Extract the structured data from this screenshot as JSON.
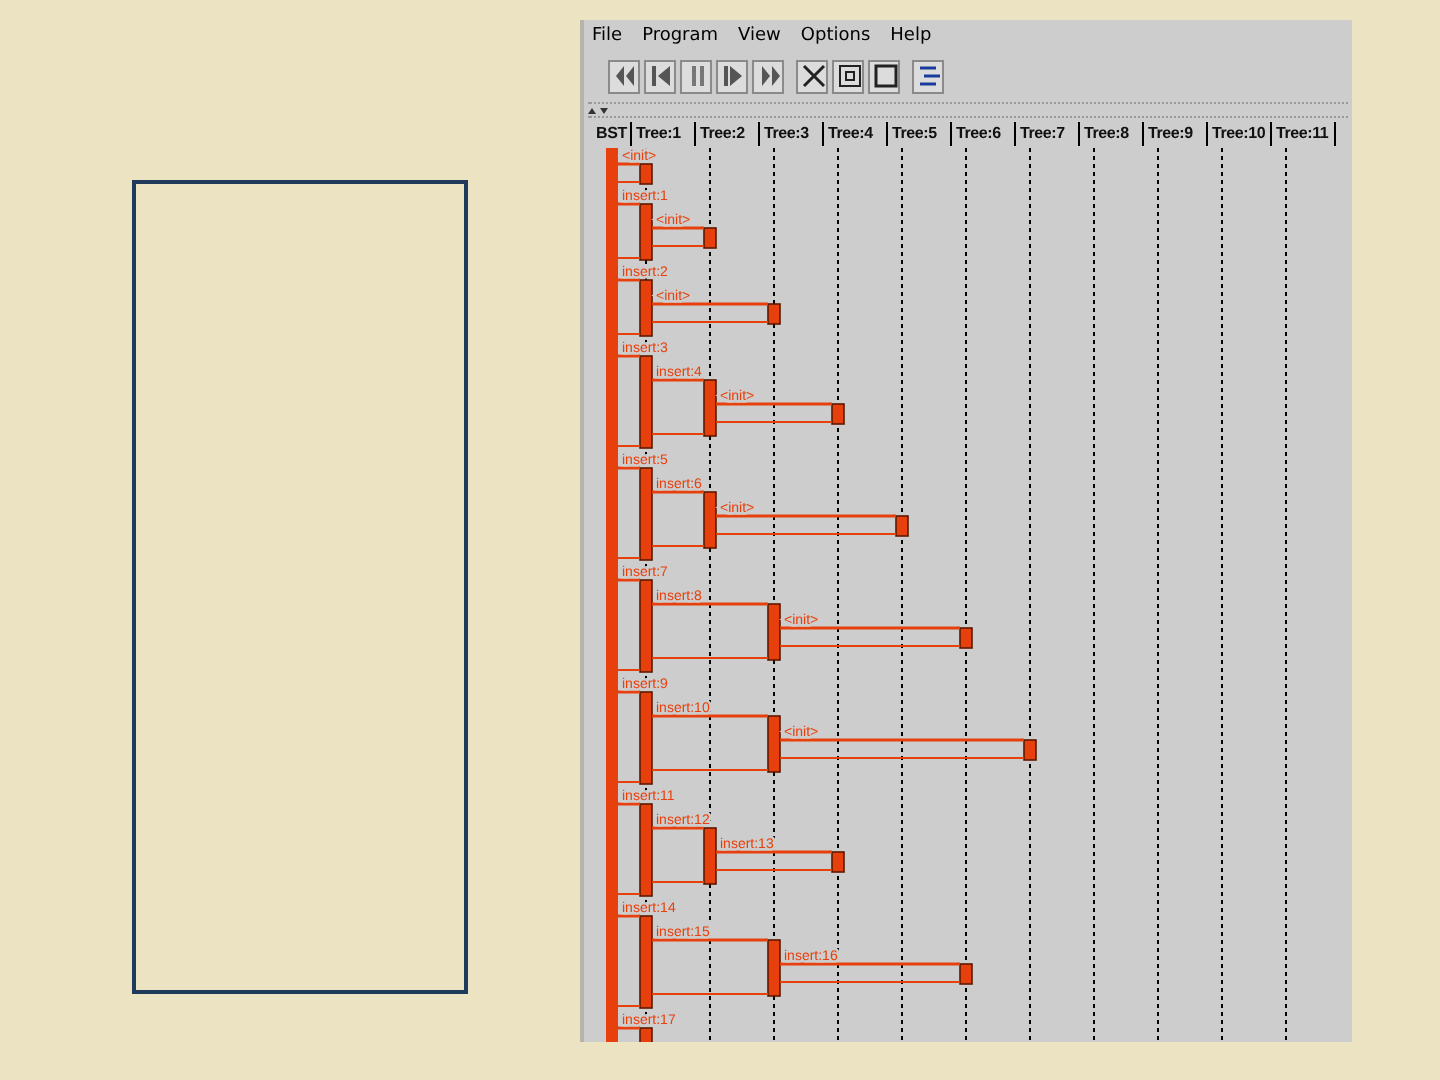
{
  "menu": [
    "File",
    "Program",
    "View",
    "Options",
    "Help"
  ],
  "lifelines": [
    "BST",
    "Tree:1",
    "Tree:2",
    "Tree:3",
    "Tree:4",
    "Tree:5",
    "Tree:6",
    "Tree:7",
    "Tree:8",
    "Tree:9",
    "Tree:10",
    "Tree:11"
  ],
  "calls": [
    {
      "label": "<init>"
    },
    {
      "label": "insert:1",
      "children": [
        {
          "label": "<init>"
        }
      ]
    },
    {
      "label": "insert:2",
      "children": [
        {
          "label": "<init>"
        }
      ]
    },
    {
      "label": "insert:3",
      "children": [
        {
          "label": "insert:4",
          "children": [
            {
              "label": "<init>"
            }
          ]
        }
      ]
    },
    {
      "label": "insert:5",
      "children": [
        {
          "label": "insert:6",
          "children": [
            {
              "label": "<init>"
            }
          ]
        }
      ]
    },
    {
      "label": "insert:7",
      "children": [
        {
          "label": "insert:8",
          "children": [
            {
              "label": "<init>"
            }
          ]
        }
      ]
    },
    {
      "label": "insert:9",
      "children": [
        {
          "label": "insert:10",
          "children": [
            {
              "label": "<init>"
            }
          ]
        }
      ]
    },
    {
      "label": "insert:11",
      "children": [
        {
          "label": "insert:12",
          "children": [
            {
              "label": "insert:13"
            }
          ]
        }
      ]
    },
    {
      "label": "insert:14",
      "children": [
        {
          "label": "insert:15",
          "children": [
            {
              "label": "insert:16"
            }
          ]
        }
      ]
    },
    {
      "label": "insert:17"
    }
  ]
}
